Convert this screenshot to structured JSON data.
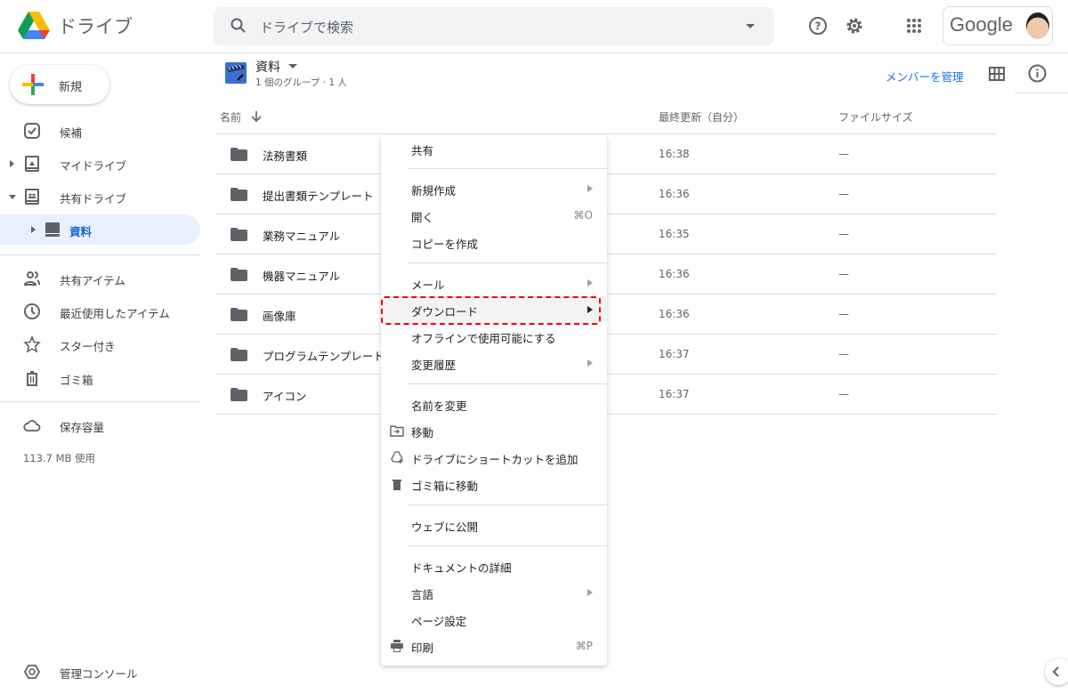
{
  "header": {
    "app_name": "ドライブ",
    "search_placeholder": "ドライブで検索",
    "account_label": "Google"
  },
  "sidebar": {
    "new_label": "新規",
    "items": [
      {
        "label": "候補",
        "icon": "check-box-icon"
      },
      {
        "label": "マイドライブ",
        "icon": "my-drive-icon"
      },
      {
        "label": "共有ドライブ",
        "icon": "shared-drives-icon"
      },
      {
        "label": "資料",
        "icon": "drive-icon"
      },
      {
        "label": "共有アイテム",
        "icon": "people-icon"
      },
      {
        "label": "最近使用したアイテム",
        "icon": "clock-icon"
      },
      {
        "label": "スター付き",
        "icon": "star-icon"
      },
      {
        "label": "ゴミ箱",
        "icon": "trash-icon"
      },
      {
        "label": "保存容量",
        "icon": "cloud-icon"
      }
    ],
    "storage_used": "113.7 MB 使用",
    "admin_console": "管理コンソール"
  },
  "folder": {
    "title": "資料",
    "subtitle": "1 個のグループ · 1 人",
    "manage_members": "メンバーを管理"
  },
  "table": {
    "columns": {
      "name": "名前",
      "modified": "最終更新（自分）",
      "size": "ファイルサイズ"
    },
    "rows": [
      {
        "name": "法務書類",
        "modified": "16:38",
        "size": "—"
      },
      {
        "name": "提出書類テンプレート",
        "modified": "16:36",
        "size": "—"
      },
      {
        "name": "業務マニュアル",
        "modified": "16:35",
        "size": "—"
      },
      {
        "name": "機器マニュアル",
        "modified": "16:36",
        "size": "—"
      },
      {
        "name": "画像庫",
        "modified": "16:36",
        "size": "—"
      },
      {
        "name": "プログラムテンプレート",
        "modified": "16:37",
        "size": "—"
      },
      {
        "name": "アイコン",
        "modified": "16:37",
        "size": "—"
      }
    ]
  },
  "menu": {
    "share": "共有",
    "new": "新規作成",
    "open": "開く",
    "open_shortcut": "⌘O",
    "copy": "コピーを作成",
    "email": "メール",
    "download": "ダウンロード",
    "offline": "オフラインで使用可能にする",
    "history": "変更履歴",
    "rename": "名前を変更",
    "move": "移動",
    "add_shortcut": "ドライブにショートカットを追加",
    "trash": "ゴミ箱に移動",
    "publish": "ウェブに公開",
    "details": "ドキュメントの詳細",
    "language": "言語",
    "page_setup": "ページ設定",
    "print": "印刷",
    "print_shortcut": "⌘P"
  },
  "colors": {
    "accent": "#1a73e8",
    "highlight": "#e00000"
  }
}
